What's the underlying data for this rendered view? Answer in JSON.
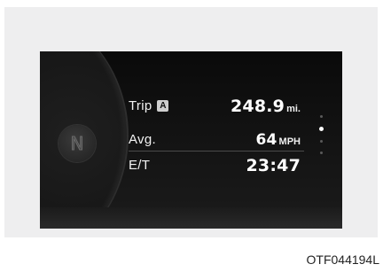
{
  "cluster": {
    "gear_indicator": "N",
    "rows": [
      {
        "label": "Trip",
        "badge": "A",
        "value": "248.9",
        "unit": "mi."
      },
      {
        "label": "Avg.",
        "value": "64",
        "unit": "MPH"
      },
      {
        "label": "E/T",
        "value": "23:47"
      }
    ],
    "page_indicator": {
      "total": 4,
      "active_index": 1
    }
  },
  "figure_code": "OTF044194L"
}
